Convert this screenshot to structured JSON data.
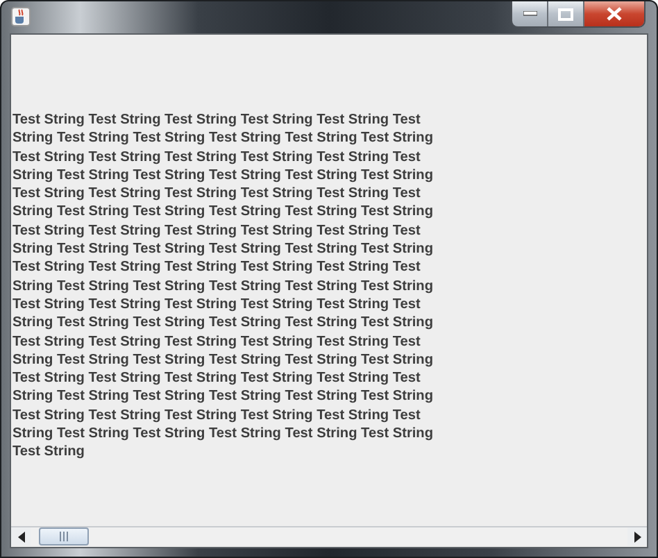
{
  "text_area": {
    "lines": [
      "Test String Test String Test String Test String Test String Test",
      "String Test String Test String Test String Test String Test String",
      "Test String Test String Test String Test String Test String Test",
      "String Test String Test String Test String Test String Test String",
      "Test String Test String Test String Test String Test String Test",
      "String Test String Test String Test String Test String Test String",
      "Test String Test String Test String Test String Test String Test",
      "String Test String Test String Test String Test String Test String",
      "Test String Test String Test String Test String Test String Test",
      "String Test String Test String Test String Test String Test String",
      "Test String Test String Test String Test String Test String Test",
      "String Test String Test String Test String Test String Test String",
      "Test String Test String Test String Test String Test String Test",
      "String Test String Test String Test String Test String Test String",
      "Test String Test String Test String Test String Test String Test",
      "String Test String Test String Test String Test String Test String",
      "Test String Test String Test String Test String Test String Test",
      "String Test String Test String Test String Test String Test String",
      "Test String"
    ]
  }
}
